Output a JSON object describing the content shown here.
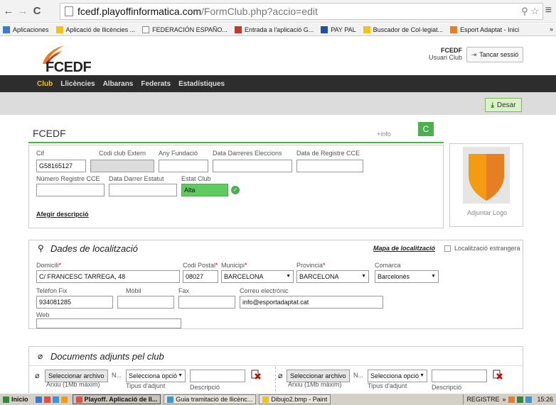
{
  "browser": {
    "url_host": "fcedf.playoffinformatica.com",
    "url_path": "/FormClub.php?accio=edit",
    "bookmarks_more": "»",
    "bookmarks": [
      {
        "label": "Aplicaciones",
        "color": "#3c78d8"
      },
      {
        "label": "Aplicació de llicències ...",
        "color": "#f1c40f"
      },
      {
        "label": "FEDERACIÓN ESPAÑO...",
        "color": "#ffffff"
      },
      {
        "label": "Entrada a l'aplicació G...",
        "color": "#c0392b"
      },
      {
        "label": "PAY PAL",
        "color": "#1f4fa3"
      },
      {
        "label": "Buscador de Col·legiat...",
        "color": "#f1c40f"
      },
      {
        "label": "Esport Adaptat - Inici",
        "color": "#e67e22"
      }
    ]
  },
  "header": {
    "logo_text": "FCEDF",
    "user_name": "FCEDF",
    "user_role": "Usuari Club",
    "logout_label": "Tancar sessió"
  },
  "nav": {
    "items": [
      "Club",
      "Llicències",
      "Albarans",
      "Federats",
      "Estadístiques"
    ]
  },
  "toolbar": {
    "save_label": "Desar"
  },
  "club": {
    "title": "FCEDF",
    "info_link": "+info",
    "badge": "C",
    "labels": {
      "cif": "Cif",
      "codi_extern": "Codi club Extern",
      "any_fundacio": "Any Fundació",
      "data_eleccions": "Data Darreres Eleccions",
      "data_registre": "Data de Registre CCE",
      "num_registre": "Número Registre CCE",
      "data_estatut": "Data Darrer Estatut",
      "estat": "Estat Club"
    },
    "values": {
      "cif": "G58165127",
      "codi_extern": "",
      "any_fundacio": "",
      "data_eleccions": "",
      "data_registre": "",
      "num_registre": "",
      "data_estatut": "",
      "estat": "Alta"
    },
    "add_description": "Afegir descripció",
    "logo_caption": "Adjuntar Logo"
  },
  "localitzacio": {
    "title": "Dades de localització",
    "map_link": "Mapa de localització",
    "foreign_label": "Localització estrangera",
    "labels": {
      "domicili": "Domicili",
      "codi_postal": "Codi Postal",
      "municipi": "Municipi",
      "provincia": "Provincia",
      "comarca": "Comarca",
      "telefon": "Teléfon Fix",
      "mobil": "Mòbil",
      "fax": "Fax",
      "correu": "Correu electrònic",
      "web": "Web"
    },
    "values": {
      "domicili": "C/ FRANCESC TARREGA, 48",
      "codi_postal": "08027",
      "municipi": "BARCELONA",
      "provincia": "BARCELONA",
      "comarca": "Barcelonès",
      "telefon": "934081285",
      "mobil": "",
      "fax": "",
      "correu": "info@esportadaptat.cat",
      "web": ""
    },
    "required_mark": "*"
  },
  "documents": {
    "title": "Documents adjunts pel club",
    "file_button": "Seleccionar archivo",
    "file_name": "N...",
    "file_hint": "Arxiu (1Mb màxim)",
    "type_placeholder": "Selecciona opció",
    "type_label": "Tipus d'adjunt",
    "desc_label": "Descripció"
  },
  "taskbar": {
    "start": "Inicio",
    "items": [
      "Playoff. Aplicació de ll...",
      "Guia tramitació de llicènc...",
      "Dibujo2.bmp - Paint"
    ],
    "tray_label": "REGISTRE",
    "tray_more": "»",
    "clock": "15:26"
  }
}
